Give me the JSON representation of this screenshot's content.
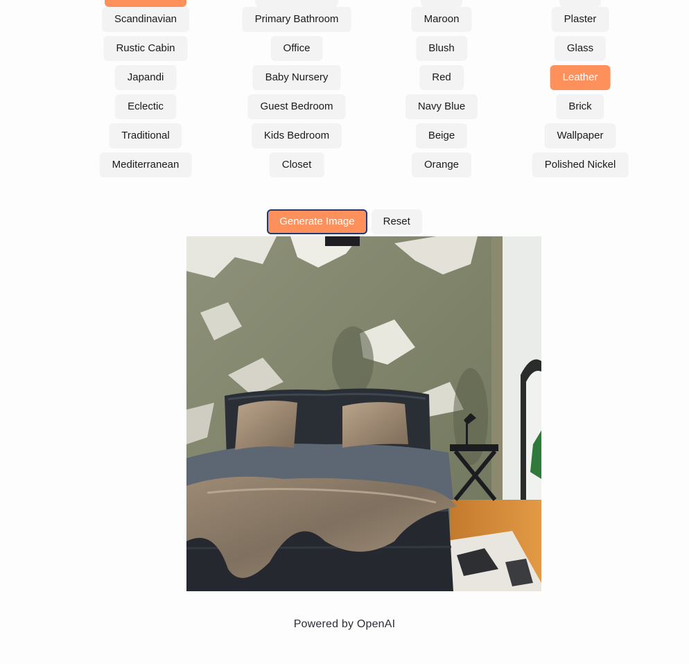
{
  "styles": {
    "items": [
      "",
      "Scandinavian",
      "Rustic Cabin",
      "Japandi",
      "Eclectic",
      "Traditional",
      "Mediterranean"
    ],
    "selected_index": 0
  },
  "rooms": {
    "items": [
      "",
      "Primary Bathroom",
      "Office",
      "Baby Nursery",
      "Guest Bedroom",
      "Kids Bedroom",
      "Closet"
    ],
    "selected_index": -1
  },
  "colors": {
    "items": [
      "",
      "Maroon",
      "Blush",
      "Red",
      "Navy Blue",
      "Beige",
      "Orange"
    ],
    "selected_index": -1
  },
  "materials": {
    "items": [
      "",
      "Plaster",
      "Glass",
      "Leather",
      "Brick",
      "Wallpaper",
      "Polished Nickel"
    ],
    "selected_index": 3
  },
  "actions": {
    "generate_label": "Generate Image",
    "reset_label": "Reset"
  },
  "footer": {
    "text": "Powered by OpenAI"
  },
  "theme": {
    "accent": "#fe915b",
    "chip_bg": "#f3f3f3",
    "focus_ring": "#1e3a6e"
  }
}
